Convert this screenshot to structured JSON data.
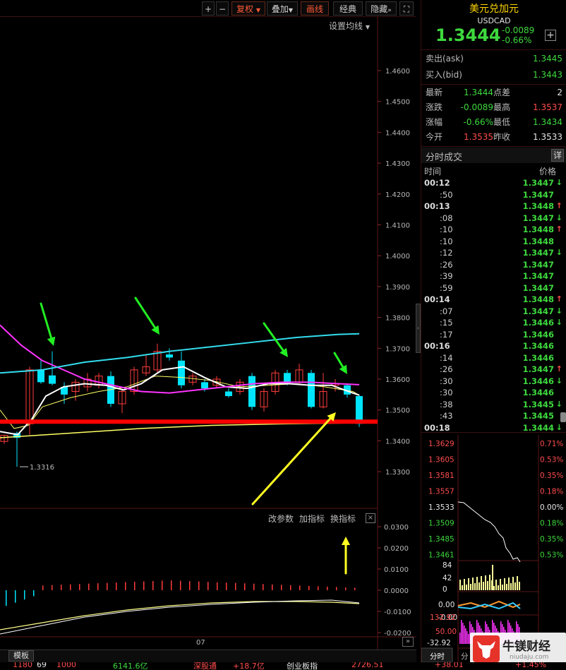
{
  "toolbar": {
    "plus": "+",
    "minus": "−",
    "fuquan": "复权",
    "diejia": "叠加",
    "huaxian": "画线",
    "jingdian": "经典",
    "yincang": "隐藏",
    "fullscreen": "⛶"
  },
  "chart": {
    "set_ma": "设置均线",
    "low_label": "1.3316",
    "date_label": "07",
    "price_ticks": [
      "1.4600",
      "1.4500",
      "1.4400",
      "1.4300",
      "1.4200",
      "1.4100",
      "1.4000",
      "1.3900",
      "1.3800",
      "1.3700",
      "1.3600",
      "1.3500",
      "1.3400",
      "1.3300"
    ],
    "indicator_buttons": [
      "改参数",
      "加指标",
      "换指标"
    ],
    "indicator_close": "×",
    "osc_ticks": [
      "0.0300",
      "0.0200",
      "0.0100",
      "0.0000",
      "-0.0100",
      "-0.0200"
    ],
    "colors": {
      "up": "#ff3b3b",
      "down": "#00e5ff",
      "ma_white": "#ffffff",
      "ma_magenta": "#ff33ff",
      "ma_cyan": "#33ddee",
      "ma_yellow": "#ffff66",
      "support": "#ff0000",
      "annot_green": "#22ee22",
      "annot_yellow": "#ffff22"
    }
  },
  "bottom": {
    "template_tab": "模板",
    "forward": "»"
  },
  "status_bar": [
    "1180",
    "69",
    "1000",
    "6141.6亿",
    "深股通",
    "+18.7亿",
    "创业板指",
    "2726.51",
    "+38.01",
    "+1.45%"
  ],
  "right_panel": {
    "title": "美元兑加元",
    "code": "USDCAD",
    "price": "1.3444",
    "change": "-0.0089",
    "change_pct": "-0.66%",
    "add_button": "+",
    "ask_label": "卖出(ask)",
    "ask_value": "1.3445",
    "bid_label": "买入(bid)",
    "bid_value": "1.3443",
    "stats": [
      {
        "l1": "最新",
        "v1": "1.3444",
        "c1": "g",
        "l2": "点差",
        "v2": "2",
        "c2": "w"
      },
      {
        "l1": "涨跌",
        "v1": "-0.0089",
        "c1": "g",
        "l2": "最高",
        "v2": "1.3537",
        "c2": "r"
      },
      {
        "l1": "涨幅",
        "v1": "-0.66%",
        "c1": "g",
        "l2": "最低",
        "v2": "1.3434",
        "c2": "g"
      },
      {
        "l1": "今开",
        "v1": "1.3535",
        "c1": "r",
        "l2": "昨收",
        "v2": "1.3533",
        "c2": "w"
      }
    ],
    "ticks_title": "分时成交",
    "ticks_detail": "详",
    "col_time": "时间",
    "col_price": "价格",
    "ticks": [
      {
        "t": "00:12",
        "major": true,
        "p": "1.3447",
        "d": "↓",
        "dc": "g"
      },
      {
        "t": ":50",
        "major": false,
        "p": "1.3447",
        "d": "",
        "dc": "w"
      },
      {
        "t": "00:13",
        "major": true,
        "p": "1.3448",
        "d": "↑",
        "dc": "r"
      },
      {
        "t": ":08",
        "major": false,
        "p": "1.3447",
        "d": "↓",
        "dc": "g"
      },
      {
        "t": ":10",
        "major": false,
        "p": "1.3448",
        "d": "↑",
        "dc": "r"
      },
      {
        "t": ":10",
        "major": false,
        "p": "1.3448",
        "d": "",
        "dc": "w"
      },
      {
        "t": ":12",
        "major": false,
        "p": "1.3447",
        "d": "↓",
        "dc": "g"
      },
      {
        "t": ":26",
        "major": false,
        "p": "1.3447",
        "d": "",
        "dc": "w"
      },
      {
        "t": ":39",
        "major": false,
        "p": "1.3447",
        "d": "",
        "dc": "w"
      },
      {
        "t": ":59",
        "major": false,
        "p": "1.3447",
        "d": "",
        "dc": "w"
      },
      {
        "t": "00:14",
        "major": true,
        "p": "1.3448",
        "d": "↑",
        "dc": "r"
      },
      {
        "t": ":07",
        "major": false,
        "p": "1.3447",
        "d": "↓",
        "dc": "g"
      },
      {
        "t": ":15",
        "major": false,
        "p": "1.3446",
        "d": "↓",
        "dc": "g"
      },
      {
        "t": ":17",
        "major": false,
        "p": "1.3446",
        "d": "",
        "dc": "w"
      },
      {
        "t": "00:16",
        "major": true,
        "p": "1.3446",
        "d": "",
        "dc": "w"
      },
      {
        "t": ":14",
        "major": false,
        "p": "1.3446",
        "d": "",
        "dc": "w"
      },
      {
        "t": ":26",
        "major": false,
        "p": "1.3447",
        "d": "↑",
        "dc": "r"
      },
      {
        "t": ":30",
        "major": false,
        "p": "1.3446",
        "d": "↓",
        "dc": "g"
      },
      {
        "t": ":30",
        "major": false,
        "p": "1.3446",
        "d": "",
        "dc": "w"
      },
      {
        "t": ":38",
        "major": false,
        "p": "1.3445",
        "d": "↓",
        "dc": "g"
      },
      {
        "t": ":43",
        "major": false,
        "p": "1.3445",
        "d": "",
        "dc": "w"
      },
      {
        "t": "00:18",
        "major": true,
        "p": "1.3444",
        "d": "↓",
        "dc": "g"
      }
    ],
    "mini": {
      "left_labels": [
        "1.3629",
        "1.3605",
        "1.3581",
        "1.3557",
        "1.3533",
        "1.3509",
        "1.3485",
        "1.3461"
      ],
      "right_labels": [
        "0.71%",
        "0.53%",
        "0.35%",
        "0.18%",
        "0.00%",
        "0.18%",
        "0.35%",
        "0.53%"
      ],
      "vol_labels": [
        "84",
        "42",
        "0"
      ],
      "ind_labels": [
        "0.00",
        "-0.00"
      ],
      "ind2_labels": [
        "132.92",
        "50.00",
        "-32.92"
      ],
      "tab": "分时",
      "tab2": "分"
    }
  },
  "watermark": {
    "title": "牛镁财经",
    "url": "niudaju.com"
  }
}
